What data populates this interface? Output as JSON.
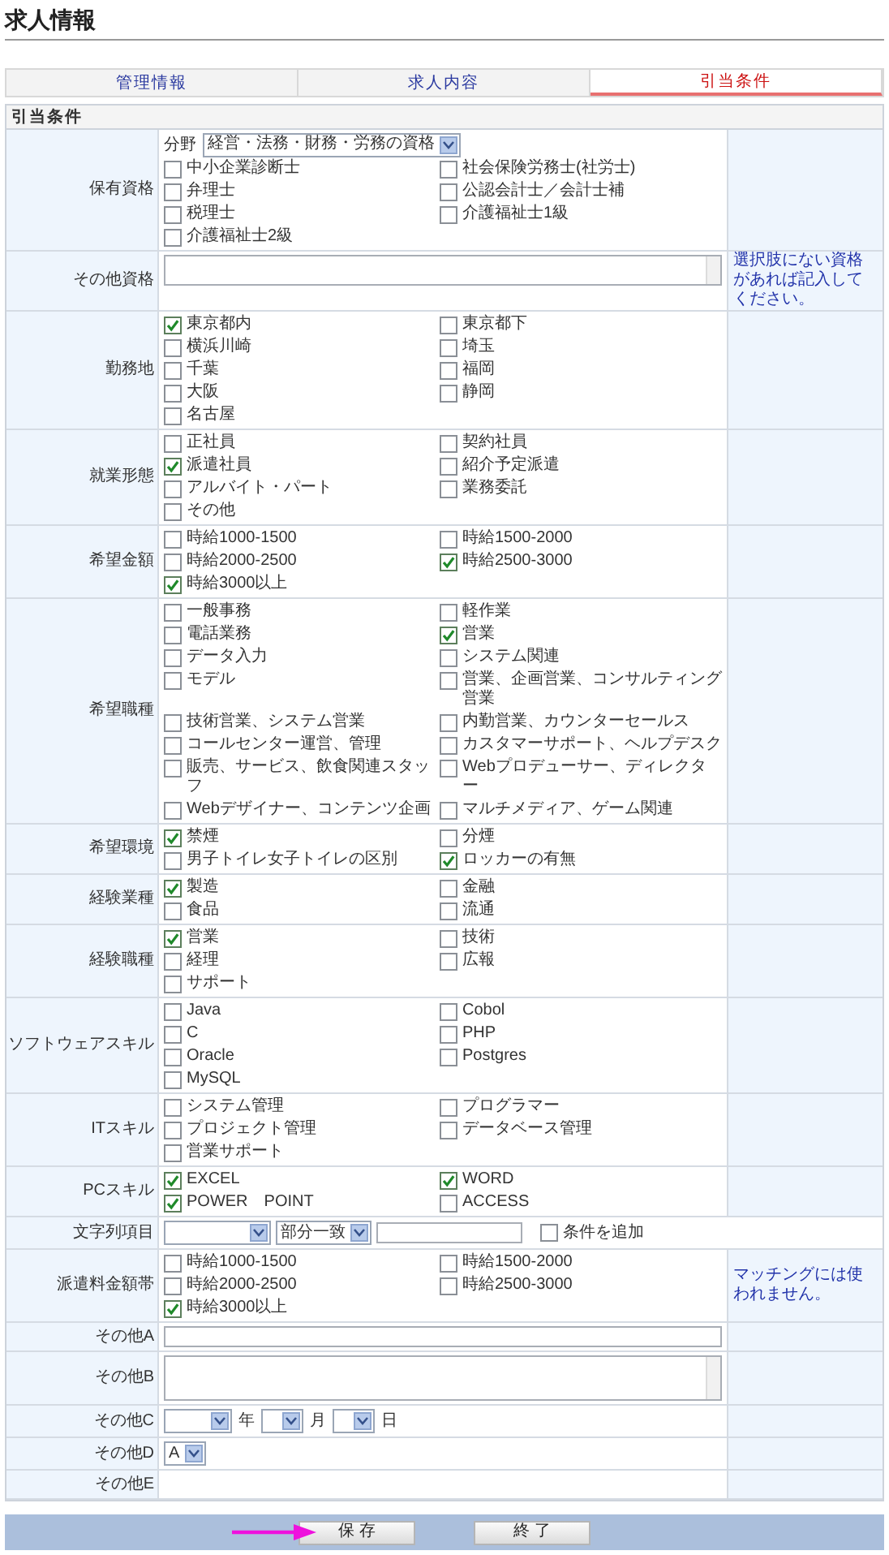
{
  "page_title": "求人情報",
  "tabs": [
    {
      "label": "管理情報",
      "selected": false
    },
    {
      "label": "求人内容",
      "selected": false
    },
    {
      "label": "引当条件",
      "selected": true
    }
  ],
  "section_title": "引当条件",
  "rows": [
    {
      "kind": "checks",
      "label": "保有資格",
      "field": {
        "label": "分野",
        "value": "経営・法務・財務・労務の資格"
      },
      "options": [
        {
          "label": "中小企業診断士",
          "checked": false
        },
        {
          "label": "社会保険労務士(社労士)",
          "checked": false
        },
        {
          "label": "弁理士",
          "checked": false
        },
        {
          "label": "公認会計士／会計士補",
          "checked": false
        },
        {
          "label": "税理士",
          "checked": false
        },
        {
          "label": "介護福祉士1級",
          "checked": false
        },
        {
          "label": "介護福祉士2級",
          "checked": false
        }
      ]
    },
    {
      "kind": "textarea",
      "label": "その他資格",
      "note": "選択肢にない資格があれば記入してください。"
    },
    {
      "kind": "checks",
      "label": "勤務地",
      "options": [
        {
          "label": "東京都内",
          "checked": true
        },
        {
          "label": "東京都下",
          "checked": false
        },
        {
          "label": "横浜川崎",
          "checked": false
        },
        {
          "label": "埼玉",
          "checked": false
        },
        {
          "label": "千葉",
          "checked": false
        },
        {
          "label": "福岡",
          "checked": false
        },
        {
          "label": "大阪",
          "checked": false
        },
        {
          "label": "静岡",
          "checked": false
        },
        {
          "label": "名古屋",
          "checked": false
        }
      ]
    },
    {
      "kind": "checks",
      "label": "就業形態",
      "options": [
        {
          "label": "正社員",
          "checked": false
        },
        {
          "label": "契約社員",
          "checked": false
        },
        {
          "label": "派遣社員",
          "checked": true
        },
        {
          "label": "紹介予定派遣",
          "checked": false
        },
        {
          "label": "アルバイト・パート",
          "checked": false
        },
        {
          "label": "業務委託",
          "checked": false
        },
        {
          "label": "その他",
          "checked": false
        }
      ]
    },
    {
      "kind": "checks",
      "label": "希望金額",
      "options": [
        {
          "label": "時給1000-1500",
          "checked": false
        },
        {
          "label": "時給1500-2000",
          "checked": false
        },
        {
          "label": "時給2000-2500",
          "checked": false
        },
        {
          "label": "時給2500-3000",
          "checked": true
        },
        {
          "label": "時給3000以上",
          "checked": true
        }
      ]
    },
    {
      "kind": "checks",
      "label": "希望職種",
      "options": [
        {
          "label": "一般事務",
          "checked": false
        },
        {
          "label": "軽作業",
          "checked": false
        },
        {
          "label": "電話業務",
          "checked": false
        },
        {
          "label": "営業",
          "checked": true
        },
        {
          "label": "データ入力",
          "checked": false
        },
        {
          "label": "システム関連",
          "checked": false
        },
        {
          "label": "モデル",
          "checked": false
        },
        {
          "label": "営業、企画営業、コンサルティング営業",
          "checked": false
        },
        {
          "label": "技術営業、システム営業",
          "checked": false
        },
        {
          "label": "内勤営業、カウンターセールス",
          "checked": false
        },
        {
          "label": "コールセンター運営、管理",
          "checked": false
        },
        {
          "label": "カスタマーサポート、ヘルプデスク",
          "checked": false
        },
        {
          "label": "販売、サービス、飲食関連スタッフ",
          "checked": false
        },
        {
          "label": "Webプロデューサー、ディレクター",
          "checked": false
        },
        {
          "label": "Webデザイナー、コンテンツ企画",
          "checked": false
        },
        {
          "label": "マルチメディア、ゲーム関連",
          "checked": false
        }
      ]
    },
    {
      "kind": "checks",
      "label": "希望環境",
      "options": [
        {
          "label": "禁煙",
          "checked": true
        },
        {
          "label": "分煙",
          "checked": false
        },
        {
          "label": "男子トイレ女子トイレの区別",
          "checked": false
        },
        {
          "label": "ロッカーの有無",
          "checked": true
        }
      ]
    },
    {
      "kind": "checks",
      "label": "経験業種",
      "options": [
        {
          "label": "製造",
          "checked": true
        },
        {
          "label": "金融",
          "checked": false
        },
        {
          "label": "食品",
          "checked": false
        },
        {
          "label": "流通",
          "checked": false
        }
      ]
    },
    {
      "kind": "checks",
      "label": "経験職種",
      "options": [
        {
          "label": "営業",
          "checked": true
        },
        {
          "label": "技術",
          "checked": false
        },
        {
          "label": "経理",
          "checked": false
        },
        {
          "label": "広報",
          "checked": false
        },
        {
          "label": "サポート",
          "checked": false
        }
      ]
    },
    {
      "kind": "checks",
      "label": "ソフトウェアスキル",
      "options": [
        {
          "label": "Java",
          "checked": false
        },
        {
          "label": "Cobol",
          "checked": false
        },
        {
          "label": "C",
          "checked": false
        },
        {
          "label": "PHP",
          "checked": false
        },
        {
          "label": "Oracle",
          "checked": false
        },
        {
          "label": "Postgres",
          "checked": false
        },
        {
          "label": "MySQL",
          "checked": false
        }
      ]
    },
    {
      "kind": "checks",
      "label": "ITスキル",
      "options": [
        {
          "label": "システム管理",
          "checked": false
        },
        {
          "label": "プログラマー",
          "checked": false
        },
        {
          "label": "プロジェクト管理",
          "checked": false
        },
        {
          "label": "データベース管理",
          "checked": false
        },
        {
          "label": "営業サポート",
          "checked": false
        }
      ]
    },
    {
      "kind": "checks",
      "label": "PCスキル",
      "options": [
        {
          "label": "EXCEL",
          "checked": true
        },
        {
          "label": "WORD",
          "checked": true
        },
        {
          "label": "POWER　POINT",
          "checked": true
        },
        {
          "label": "ACCESS",
          "checked": false
        }
      ]
    },
    {
      "kind": "search",
      "label": "文字列項目",
      "match": "部分一致",
      "add": {
        "label": "条件を追加",
        "checked": false
      }
    },
    {
      "kind": "checks",
      "label": "派遣料金額帯",
      "note": "マッチングには使われません。",
      "options": [
        {
          "label": "時給1000-1500",
          "checked": false
        },
        {
          "label": "時給1500-2000",
          "checked": false
        },
        {
          "label": "時給2000-2500",
          "checked": false
        },
        {
          "label": "時給2500-3000",
          "checked": false
        },
        {
          "label": "時給3000以上",
          "checked": true
        }
      ]
    },
    {
      "kind": "text",
      "label": "その他A"
    },
    {
      "kind": "textarea",
      "label": "その他B"
    },
    {
      "kind": "date",
      "label": "その他C",
      "units": [
        "年",
        "月",
        "日"
      ]
    },
    {
      "kind": "select",
      "label": "その他D",
      "value": "A"
    },
    {
      "kind": "empty",
      "label": "その他E"
    }
  ],
  "buttons": [
    {
      "label": "保 存"
    },
    {
      "label": "終 了"
    }
  ]
}
